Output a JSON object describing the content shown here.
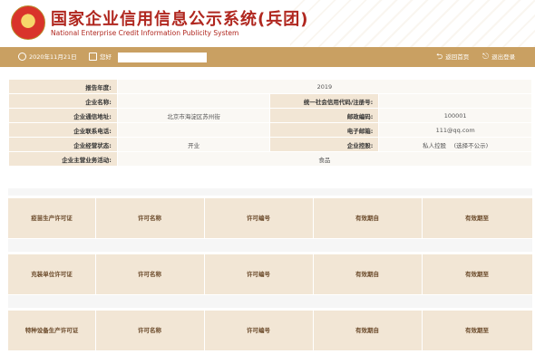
{
  "header": {
    "title": "国家企业信用信息公示系统(兵团)",
    "subtitle": "National Enterprise Credit Information Publicity System"
  },
  "toolbar": {
    "date": "2020年11月21日",
    "greeting": "您好",
    "back_label": "返回首页",
    "logout_label": "退出登录"
  },
  "info": {
    "report_year_label": "报告年度:",
    "report_year": "2019",
    "company_name_label": "企业名称:",
    "company_name": "",
    "credit_code_label": "统一社会信用代码/注册号:",
    "credit_code": "",
    "address_label": "企业通信地址:",
    "address": "北京市海淀区苏州街",
    "postcode_label": "邮政编码:",
    "postcode": "100001",
    "phone_label": "企业联系电话:",
    "phone": "",
    "email_label": "电子邮箱:",
    "email": "111@qq.com",
    "status_label": "企业经营状态:",
    "status": "开业",
    "control_label": "企业控股:",
    "control": "私人控股　 (选择不公示)",
    "business_label": "企业主营业务活动:",
    "business": "食品"
  },
  "licenses": [
    {
      "title": "疫苗生产许可证",
      "col_name": "许可名称",
      "col_number": "许可编号",
      "col_from": "有效期自",
      "col_to": "有效期至"
    },
    {
      "title": "充装单位许可证",
      "col_name": "许可名称",
      "col_number": "许可编号",
      "col_from": "有效期自",
      "col_to": "有效期至"
    },
    {
      "title": "特种设备生产许可证",
      "col_name": "许可名称",
      "col_number": "许可编号",
      "col_from": "有效期自",
      "col_to": "有效期至"
    }
  ],
  "colors": {
    "accent": "#c9a062",
    "brand": "#b0271f",
    "label_bg": "#f2e6d5"
  }
}
